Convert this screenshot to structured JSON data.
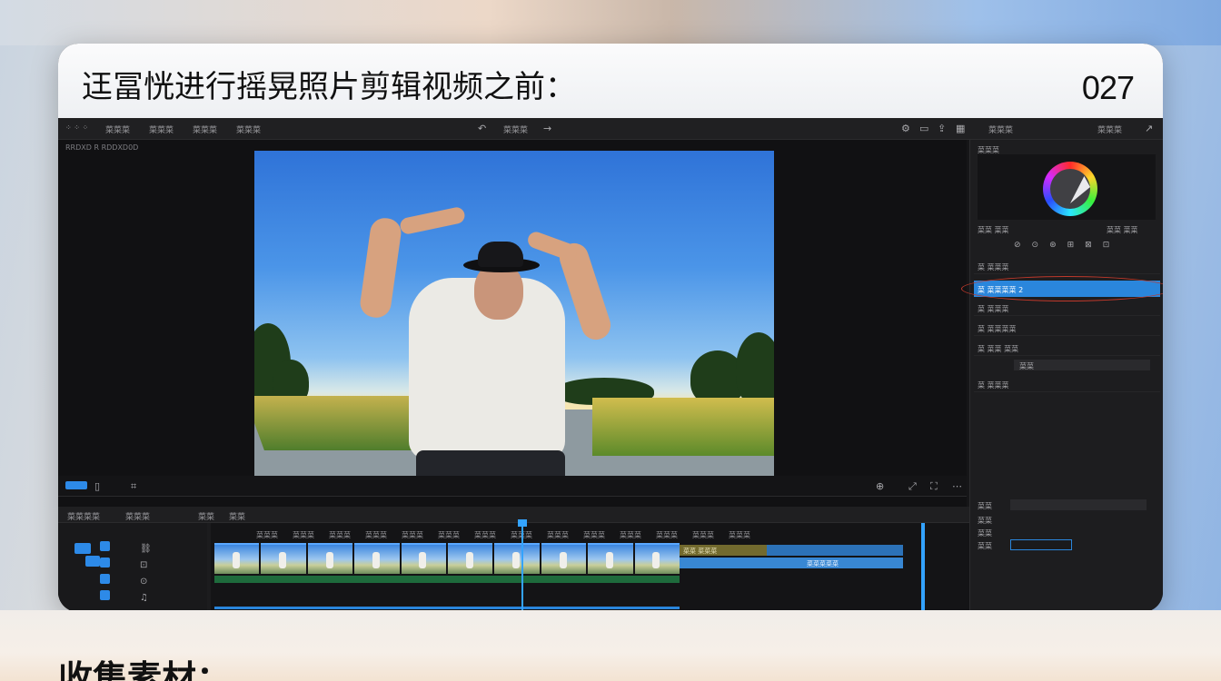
{
  "card": {
    "title": "迋冨恍进行摇晃照片剪辑视频之前：",
    "number": "027"
  },
  "section_heading": "收集素材：",
  "editor": {
    "menu": [
      "菜菜菜",
      "菜菜菜",
      "菜菜菜",
      "菜菜菜"
    ],
    "center_label": "菜菜菜",
    "right_label": "菜菜菜",
    "player_info": "RRDXD  R RDDXD0D",
    "inspector": {
      "header": "菜菜菜",
      "wheel_label": "菜菜 菜菜",
      "rows": [
        "菜 菜菜菜",
        "菜 菜菜菜菜 2",
        "菜 菜菜菜",
        "菜 菜菜菜菜",
        "菜 菜菜  菜菜",
        "菜菜",
        "菜 菜菜菜"
      ],
      "bottom_rows": [
        "菜菜",
        "菜菜",
        "菜菜",
        "菜菜"
      ]
    },
    "timeline": {
      "tabs": [
        "菜菜菜菜",
        "菜菜菜",
        "菜菜",
        "菜菜"
      ],
      "markers": [
        "菜菜菜",
        "菜菜菜",
        "菜菜菜",
        "菜菜菜",
        "菜菜菜",
        "菜菜菜",
        "菜菜菜",
        "菜菜菜",
        "菜菜菜",
        "菜菜菜",
        "菜菜菜",
        "菜菜菜",
        "菜菜菜",
        "菜菜菜"
      ],
      "audio_label": "菜菜 菜菜菜",
      "audio_label2": "菜菜菜菜菜"
    }
  },
  "colors": {
    "accent": "#2a86dc",
    "playhead": "#33a3ff",
    "panel_bg": "#1d1d1f"
  }
}
